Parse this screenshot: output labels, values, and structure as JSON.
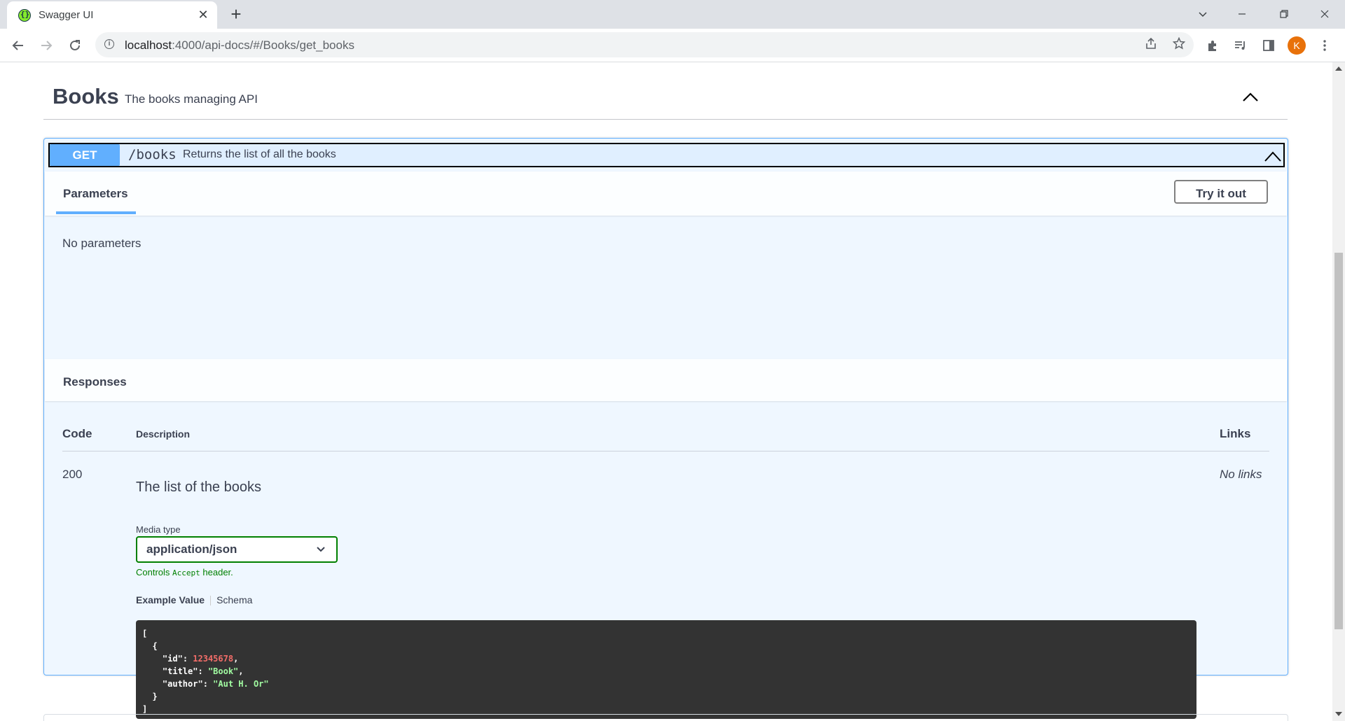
{
  "browser": {
    "tab_title": "Swagger UI",
    "tab_close": "✕",
    "new_tab": "+",
    "url_host": "localhost",
    "url_rest": ":4000/api-docs/#/Books/get_books",
    "profile_initial": "K"
  },
  "tag": {
    "name": "Books",
    "description": "The books managing API"
  },
  "operation": {
    "method": "GET",
    "path": "/books",
    "summary": "Returns the list of all the books",
    "params_tab": "Parameters",
    "try_button": "Try it out",
    "no_params": "No parameters",
    "responses_title": "Responses",
    "columns": {
      "code": "Code",
      "description": "Description",
      "links": "Links"
    },
    "response": {
      "code": "200",
      "description": "The list of the books",
      "links": "No links",
      "media_label": "Media type",
      "media_value": "application/json",
      "controls_pre": "Controls ",
      "controls_code": "Accept",
      "controls_post": " header.",
      "example_tab": "Example Value",
      "schema_tab": "Schema",
      "example": {
        "open": "[",
        "obj_open": "{",
        "id_key": "\"id\"",
        "id_val": "12345678",
        "title_key": "\"title\"",
        "title_val": "\"Book\"",
        "author_key": "\"author\"",
        "author_val": "\"Aut H. Or\"",
        "obj_close": "}",
        "close": "]"
      }
    }
  },
  "colors": {
    "get": "#61affe",
    "success": "#008000",
    "code_bg": "#333333"
  }
}
